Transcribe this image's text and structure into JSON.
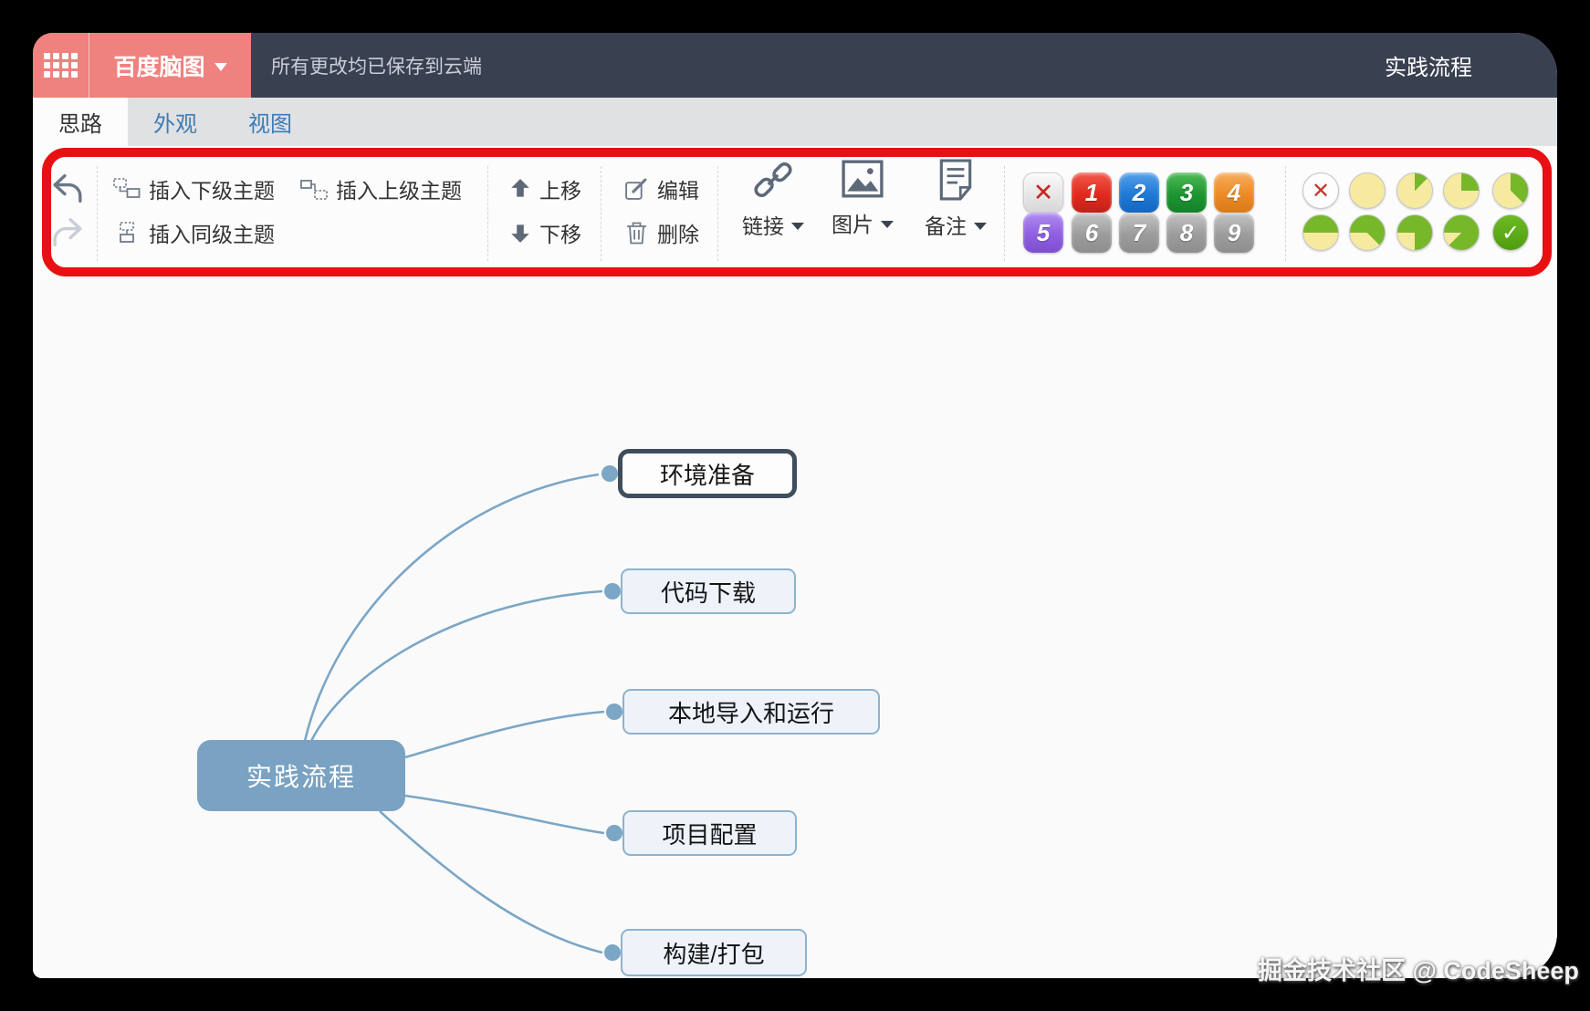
{
  "header": {
    "app_name": "百度脑图",
    "save_status": "所有更改均已保存到云端",
    "doc_title": "实践流程"
  },
  "tabs": {
    "idea": "思路",
    "appearance": "外观",
    "view": "视图"
  },
  "toolbar": {
    "insert_child": "插入下级主题",
    "insert_parent": "插入上级主题",
    "insert_sibling": "插入同级主题",
    "move_up": "上移",
    "move_down": "下移",
    "edit": "编辑",
    "delete": "删除",
    "link": "链接",
    "image": "图片",
    "note": "备注",
    "priority": {
      "clear_glyph": "✕",
      "items": [
        "1",
        "2",
        "3",
        "4",
        "5",
        "6",
        "7",
        "8",
        "9"
      ],
      "colors": {
        "1": "#e02b1d",
        "2": "#1e7ad4",
        "3": "#1d9630",
        "4": "#ec8b25",
        "5": "#8f5fe0",
        "6_9": "#9c9c9c"
      }
    },
    "progress": {
      "clear_glyph": "✕",
      "done_glyph": "✓",
      "levels": [
        "0/8",
        "1/8",
        "2/8",
        "3/8",
        "4/8",
        "5/8",
        "6/8",
        "7/8",
        "done"
      ],
      "green": "#76b82a",
      "yellow": "#f6e9a0"
    }
  },
  "mindmap": {
    "root": {
      "label": "实践流程",
      "color": "#7aa2c2"
    },
    "children": [
      {
        "label": "环境准备",
        "selected": true
      },
      {
        "label": "代码下载",
        "selected": false
      },
      {
        "label": "本地导入和运行",
        "selected": false
      },
      {
        "label": "项目配置",
        "selected": false
      },
      {
        "label": "构建/打包",
        "selected": false
      }
    ]
  },
  "watermark": "掘金技术社区 @ CodeSheep",
  "colors": {
    "brand": "#ef817e",
    "header_bg": "#394050",
    "tab_text": "#3d7cb8",
    "annotation_border": "#e81012",
    "canvas_bg": "#fafafa",
    "connector": "#7ba6c6",
    "selected_node_border": "#3f4e5c"
  }
}
